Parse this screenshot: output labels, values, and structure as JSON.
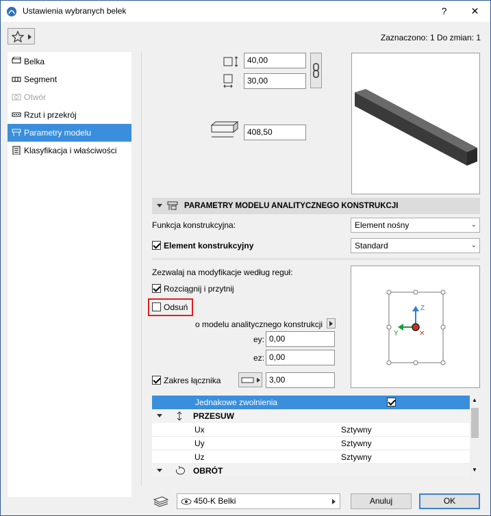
{
  "window": {
    "title": "Ustawienia wybranych belek",
    "help_label": "?",
    "close_label": "✕"
  },
  "header": {
    "status": "Zaznaczono: 1 Do zmian: 1"
  },
  "sidebar": {
    "items": [
      {
        "label": "Belka",
        "icon": "beam-icon",
        "state": "normal"
      },
      {
        "label": "Segment",
        "icon": "segment-icon",
        "state": "normal"
      },
      {
        "label": "Otwór",
        "icon": "opening-icon",
        "state": "disabled"
      },
      {
        "label": "Rzut i przekrój",
        "icon": "floor-plan-icon",
        "state": "normal"
      },
      {
        "label": "Parametry modelu analityczn...",
        "icon": "analytical-model-icon",
        "state": "selected"
      },
      {
        "label": "Klasyfikacja i właściwości",
        "icon": "classification-icon",
        "state": "normal"
      }
    ]
  },
  "geometry": {
    "width": "40,00",
    "height": "30,00",
    "length": "408,50"
  },
  "section": {
    "title": "PARAMETRY MODELU ANALITYCZNEGO KONSTRUKCJI",
    "function_label": "Funkcja konstrukcyjna:",
    "function_value": "Element nośny",
    "structural_label": "Element konstrukcyjny",
    "structural_checked": true,
    "structural_value": "Standard",
    "allow_label": "Zezwalaj na modyfikacje według reguł:",
    "stretch_label": "Rozciągnij i przytnij",
    "stretch_checked": true,
    "offset_label": "Odsuń",
    "offset_checked": false,
    "offset_of_label": "o modelu analitycznego konstrukcji",
    "ey_label": "ey:",
    "ey_value": "0,00",
    "ez_label": "ez:",
    "ez_value": "0,00",
    "link_range_label": "Zakres łącznika",
    "link_range_checked": true,
    "link_range_value": "3,00"
  },
  "axes": {
    "z": "Z",
    "y": "Y",
    "x": "✕"
  },
  "table": {
    "uniform_label": "Jednakowe zwolnienia",
    "uniform_checked": true,
    "groups": [
      {
        "title": "PRZESUW",
        "rows": [
          {
            "name": "Ux",
            "value": "Sztywny"
          },
          {
            "name": "Uy",
            "value": "Sztywny"
          },
          {
            "name": "Uz",
            "value": "Sztywny"
          }
        ]
      },
      {
        "title": "OBRÓT",
        "rows": []
      }
    ]
  },
  "footer": {
    "layer": "450-K Belki",
    "cancel_label": "Anuluj",
    "ok_label": "OK"
  },
  "colors": {
    "accent": "#3a8edc",
    "highlight_border": "#e02020"
  }
}
